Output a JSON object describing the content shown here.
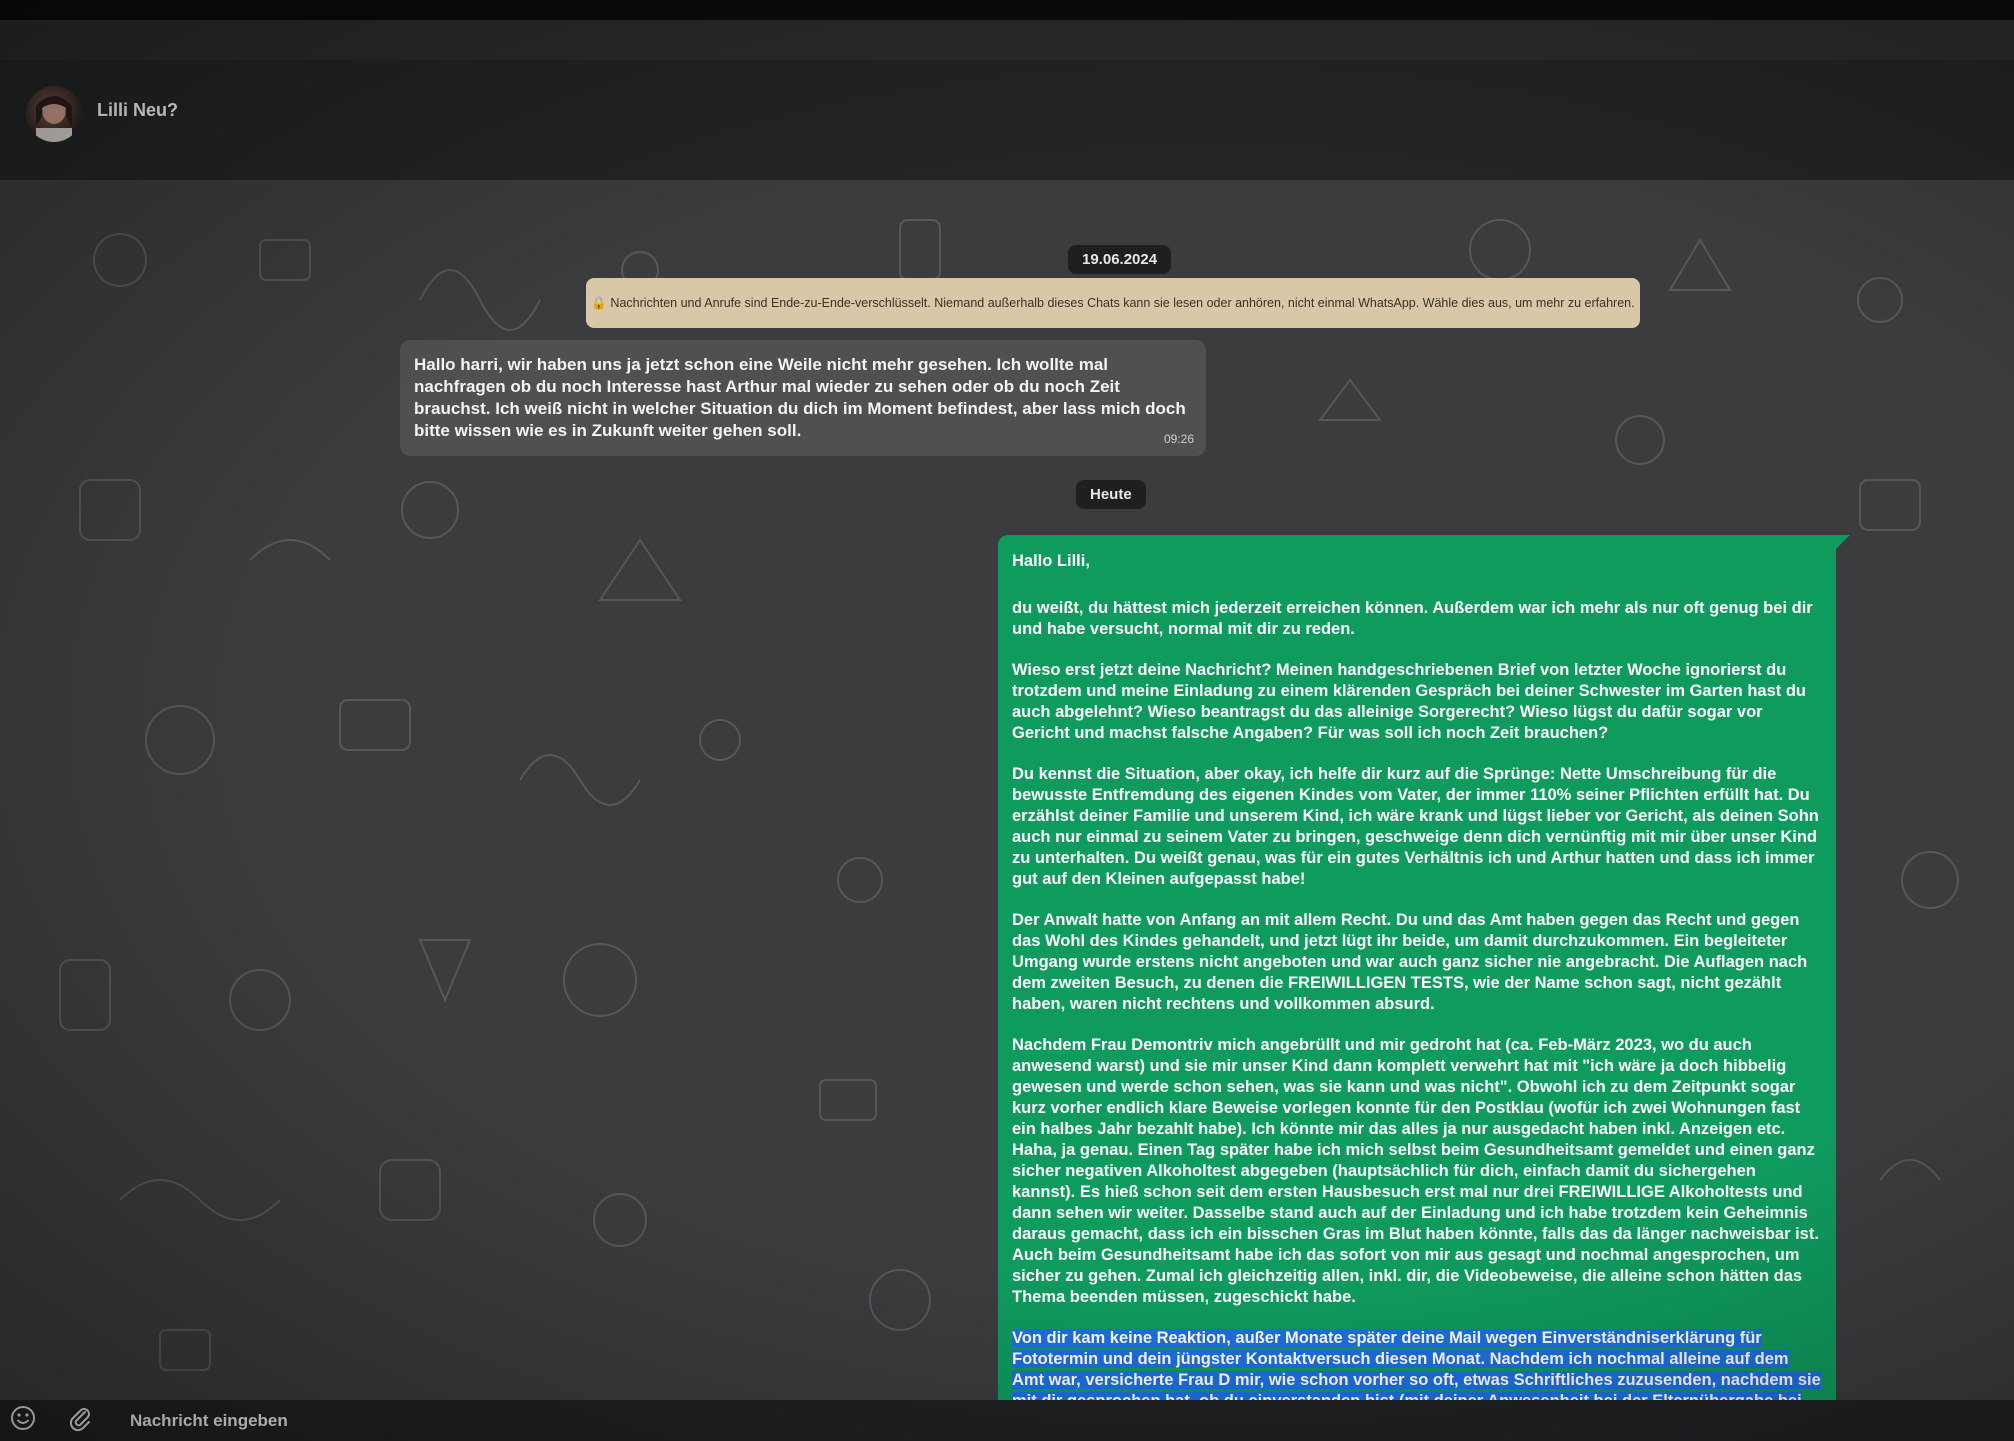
{
  "header": {
    "contact_name": "Lilli Neu?"
  },
  "chat": {
    "date_1": "19.06.2024",
    "encryption_notice": "🔒 Nachrichten und Anrufe sind Ende-zu-Ende-verschlüsselt. Niemand außerhalb dieses Chats kann sie lesen oder anhören, nicht einmal WhatsApp. Wähle dies aus, um mehr zu erfahren.",
    "incoming": {
      "text": "Hallo harri, wir haben uns ja jetzt schon eine Weile nicht mehr gesehen. Ich wollte mal nachfragen ob du noch Interesse hast Arthur mal wieder zu sehen oder ob du noch Zeit brauchst. Ich weiß nicht in welcher Situation du dich im Moment befindest, aber lass mich doch bitte wissen wie es in Zukunft weiter gehen soll.",
      "time": "09:26"
    },
    "date_2": "Heute",
    "outgoing": {
      "greeting": "Hallo Lilli,",
      "p1": "du weißt, du hättest mich jederzeit erreichen können. Außerdem war ich mehr als nur oft genug bei dir und habe versucht, normal mit dir zu reden.",
      "p2": "Wieso erst jetzt deine Nachricht? Meinen handgeschriebenen Brief von letzter Woche ignorierst du trotzdem und meine Einladung zu einem klärenden Gespräch bei deiner Schwester im Garten hast du auch abgelehnt? Wieso beantragst du das alleinige Sorgerecht? Wieso lügst du dafür sogar vor Gericht und machst falsche Angaben? Für was soll ich noch Zeit brauchen?",
      "p3": "Du kennst die Situation, aber okay, ich helfe dir kurz auf die Sprünge: Nette Umschreibung für die bewusste Entfremdung des eigenen Kindes vom Vater, der immer 110% seiner Pflichten erfüllt hat. Du erzählst deiner Familie und unserem Kind, ich wäre krank und lügst lieber vor Gericht, als deinen Sohn auch nur einmal zu seinem Vater zu bringen, geschweige denn dich vernünftig mit mir über unser Kind zu unterhalten. Du weißt genau, was für ein gutes Verhältnis ich und Arthur hatten und dass ich immer gut auf den Kleinen aufgepasst habe!",
      "p4": "Der Anwalt hatte von Anfang an mit allem Recht. Du und das Amt haben gegen das Recht und gegen das Wohl des Kindes gehandelt, und jetzt lügt ihr beide, um damit durchzukommen. Ein begleiteter Umgang wurde erstens nicht angeboten und war auch ganz sicher nie angebracht. Die Auflagen nach dem zweiten Besuch, zu denen die FREIWILLIGEN TESTS, wie der Name schon sagt, nicht gezählt haben, waren nicht rechtens und vollkommen absurd.",
      "p5": "Nachdem Frau Demontriv mich angebrüllt und mir gedroht hat (ca. Feb-März 2023, wo du auch anwesend warst) und sie mir unser Kind dann komplett verwehrt hat mit \"ich wäre ja doch hibbelig gewesen und werde schon sehen, was sie kann und was nicht\". Obwohl ich zu dem Zeitpunkt sogar kurz vorher endlich klare Beweise vorlegen konnte für den Postklau (wofür ich zwei Wohnungen fast ein halbes Jahr bezahlt habe). Ich könnte mir das alles ja nur ausgedacht haben inkl. Anzeigen etc. Haha, ja genau. Einen Tag später habe ich mich selbst beim Gesundheitsamt gemeldet und einen ganz sicher negativen Alkoholtest abgegeben (hauptsächlich für dich, einfach damit du sichergehen kannst). Es hieß schon seit dem ersten Hausbesuch erst mal nur drei FREIWILLIGE Alkoholtests und dann sehen wir weiter. Dasselbe stand auch auf der Einladung und ich habe trotzdem kein Geheimnis daraus gemacht, dass ich ein bisschen Gras im Blut haben könnte, falls das da länger nachweisbar ist. Auch beim Gesundheitsamt habe ich das sofort von mir aus gesagt und nochmal angesprochen, um sicher zu gehen. Zumal ich gleichzeitig allen, inkl. dir, die Videobeweise, die alleine schon hätten das Thema beenden müssen, zugeschickt habe.",
      "p6": "Von dir kam keine Reaktion, außer Monate später deine Mail wegen Einverständniserklärung für Fototermin und dein jüngster Kontaktversuch diesen Monat. Nachdem ich nochmal alleine auf dem Amt war, versicherte Frau D mir, wie schon vorher so oft, etwas Schriftliches zuzusenden, nachdem sie mit dir gesprochen hat, ob du einverstanden bist (mit deiner Anwesenheit bei der Elternübergabe bei deinen"
    }
  },
  "composer": {
    "placeholder": "Nachricht eingeben",
    "emoji_icon": "emoji-icon",
    "attach_icon": "paperclip-icon"
  },
  "colors": {
    "outgoing_bubble": "#0f9a5e",
    "incoming_bubble": "#4f5051",
    "banner": "#d9c7a8",
    "selection": "#1d6fe0"
  }
}
